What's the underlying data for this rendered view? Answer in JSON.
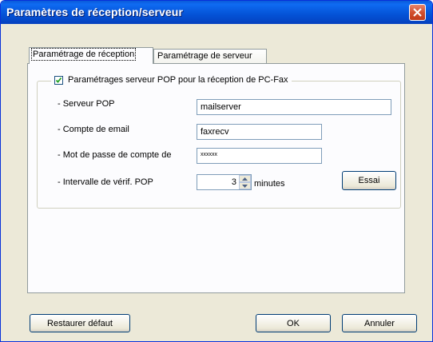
{
  "window": {
    "title": "Paramètres de réception/serveur",
    "titlebar_color": "#0452d6",
    "close_color": "#d2502f"
  },
  "tabs": [
    {
      "label": "Paramétrage de réception",
      "selected": true
    },
    {
      "label": "Paramétrage de serveur",
      "selected": false
    }
  ],
  "group": {
    "checkbox_label": "Paramétrages serveur POP pour la réception de PC-Fax",
    "checked": true
  },
  "fields": {
    "server_label": "- Serveur POP",
    "server_value": "mailserver",
    "account_label": "- Compte de email",
    "account_value": "faxrecv",
    "password_label": "- Mot de passe de compte de",
    "password_value": "xxxxxx",
    "interval_label": "- Intervalle de vérif. POP",
    "interval_value": "3",
    "interval_unit": "minutes"
  },
  "buttons": {
    "test": "Essai",
    "restore": "Restaurer défaut",
    "ok": "OK",
    "cancel": "Annuler"
  }
}
